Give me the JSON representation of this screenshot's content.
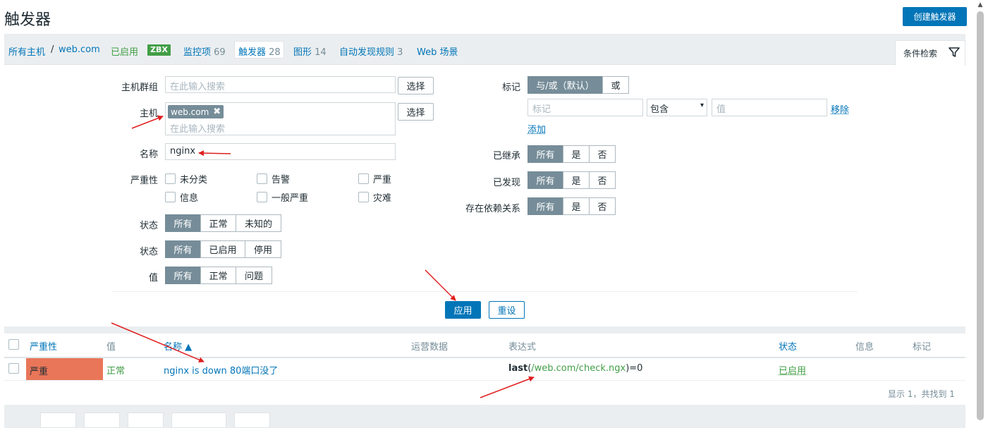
{
  "header": {
    "title": "触发器",
    "create_button": "创建触发器"
  },
  "tabs": {
    "all_hosts": "所有主机",
    "separator": "/",
    "host": "web.com",
    "enabled": "已启用",
    "zbx": "ZBX",
    "items": {
      "label": "监控项",
      "count": "69"
    },
    "triggers": {
      "label": "触发器",
      "count": "28"
    },
    "graphs": {
      "label": "图形",
      "count": "14"
    },
    "discovery": {
      "label": "自动发现规则",
      "count": "3"
    },
    "web": "Web 场景",
    "filter_tab": "条件检索"
  },
  "filter": {
    "host_group": {
      "label": "主机群组",
      "placeholder": "在此输入搜索",
      "select_btn": "选择"
    },
    "host": {
      "label": "主机",
      "chip": "web.com",
      "chip_remove": "✖",
      "placeholder": "在此输入搜索",
      "select_btn": "选择"
    },
    "name": {
      "label": "名称",
      "value": "nginx"
    },
    "severity": {
      "label": "严重性",
      "options": [
        "未分类",
        "告警",
        "严重",
        "信息",
        "一般严重",
        "灾难"
      ]
    },
    "state": {
      "label": "状态",
      "options": [
        "所有",
        "正常",
        "未知的"
      ],
      "selected": "所有"
    },
    "status": {
      "label": "状态",
      "options": [
        "所有",
        "已启用",
        "停用"
      ],
      "selected": "所有"
    },
    "value": {
      "label": "值",
      "options": [
        "所有",
        "正常",
        "问题"
      ],
      "selected": "所有"
    },
    "tags": {
      "label": "标记",
      "options": [
        "与/或（默认）",
        "或"
      ],
      "selected": "与/或（默认）",
      "tag_placeholder": "标记",
      "operator": "包含",
      "value_placeholder": "值",
      "remove": "移除",
      "add": "添加"
    },
    "inherited": {
      "label": "已继承",
      "options": [
        "所有",
        "是",
        "否"
      ],
      "selected": "所有"
    },
    "discovered": {
      "label": "已发现",
      "options": [
        "所有",
        "是",
        "否"
      ],
      "selected": "所有"
    },
    "dependencies": {
      "label": "存在依赖关系",
      "options": [
        "所有",
        "是",
        "否"
      ],
      "selected": "所有"
    },
    "apply": "应用",
    "reset": "重设"
  },
  "table": {
    "columns": [
      "严重性",
      "值",
      "名称 ▲",
      "运营数据",
      "表达式",
      "状态",
      "信息",
      "标记"
    ],
    "rows": [
      {
        "severity": "严重",
        "value": "正常",
        "name": "nginx is down 80端口没了",
        "operational_data": "",
        "expression": {
          "func": "last",
          "open": "(",
          "key": "/web.com/check.ngx",
          "close": ")=0"
        },
        "status": "已启用"
      }
    ],
    "footer": "显示 1，共找到 1"
  },
  "colors": {
    "accent": "#0275b8",
    "green": "#429e47",
    "high_severity": "#e97659",
    "neutral": "#768d99",
    "annotation_arrow": "#e02020"
  }
}
